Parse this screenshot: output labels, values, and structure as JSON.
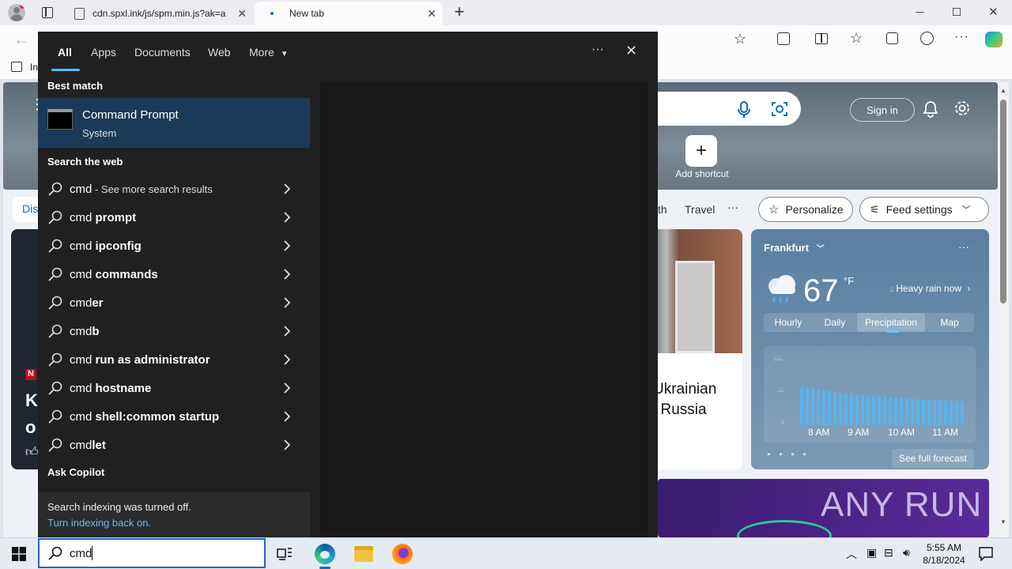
{
  "browser": {
    "tabs": [
      {
        "title": "cdn.spxl.ink/js/spm.min.js?ak=a"
      },
      {
        "title": "New tab"
      }
    ],
    "window_controls": [
      "minimize-icon",
      "restore-icon",
      "close-icon"
    ],
    "fav_fragment": "In"
  },
  "newtab": {
    "sign_in": "Sign in",
    "add_shortcut": "Add shortcut",
    "nav_items": [
      "th",
      "Travel"
    ],
    "personalize": "Personalize",
    "feed_settings": "Feed settings",
    "left_tab_fragment": "Dis",
    "news_headline_fragments": [
      "Ukrainian",
      "l Russia"
    ],
    "left_headline_fragments": [
      "K",
      "o"
    ],
    "weather": {
      "city": "Frankfurt",
      "temp": "67",
      "unit": "°F",
      "condition": "Heavy rain now",
      "tabs": [
        "Hourly",
        "Daily",
        "Precipitation",
        "Map"
      ],
      "active_tab": "Precipitation",
      "chart_times": [
        "8 AM",
        "9 AM",
        "10 AM",
        "11 AM"
      ],
      "see_full": "See full forecast",
      "precip_bars": [
        0.9,
        0.88,
        0.86,
        0.84,
        0.82,
        0.8,
        0.78,
        0.76,
        0.75,
        0.74,
        0.72,
        0.71,
        0.7,
        0.69,
        0.68,
        0.67,
        0.66,
        0.65,
        0.64,
        0.63,
        0.62,
        0.61,
        0.6,
        0.6,
        0.59,
        0.59,
        0.58,
        0.58,
        0.57,
        0.57
      ]
    },
    "ad_text": "ANY RUN"
  },
  "start_menu": {
    "filters": [
      "All",
      "Apps",
      "Documents",
      "Web",
      "More"
    ],
    "active_filter": "All",
    "best_match_heading": "Best match",
    "best_match": {
      "name": "Command Prompt",
      "type": "System"
    },
    "web_heading": "Search the web",
    "web_results": [
      {
        "prefix": "cmd",
        "bold": "",
        "suffix": " - See more search results"
      },
      {
        "prefix": "cmd ",
        "bold": "prompt",
        "suffix": ""
      },
      {
        "prefix": "cmd ",
        "bold": "ipconfig",
        "suffix": ""
      },
      {
        "prefix": "cmd ",
        "bold": "commands",
        "suffix": ""
      },
      {
        "prefix": "cmd",
        "bold": "er",
        "suffix": ""
      },
      {
        "prefix": "cmd",
        "bold": "b",
        "suffix": ""
      },
      {
        "prefix": "cmd ",
        "bold": "run as administrator",
        "suffix": ""
      },
      {
        "prefix": "cmd ",
        "bold": "hostname",
        "suffix": ""
      },
      {
        "prefix": "cmd ",
        "bold": "shell:common startup",
        "suffix": ""
      },
      {
        "prefix": "cmd",
        "bold": "let",
        "suffix": ""
      }
    ],
    "copilot_heading": "Ask Copilot",
    "indexing_notice": "Search indexing was turned off.",
    "indexing_link": "Turn indexing back on."
  },
  "taskbar": {
    "search_value": "cmd",
    "time": "5:55 AM",
    "date": "8/18/2024"
  },
  "colors": {
    "accent": "#2a62c9",
    "start_bg": "#202020",
    "best_match_bg": "#1b3a57",
    "link_blue": "#6cb8f6",
    "bar_blue": "#58b4f0"
  }
}
